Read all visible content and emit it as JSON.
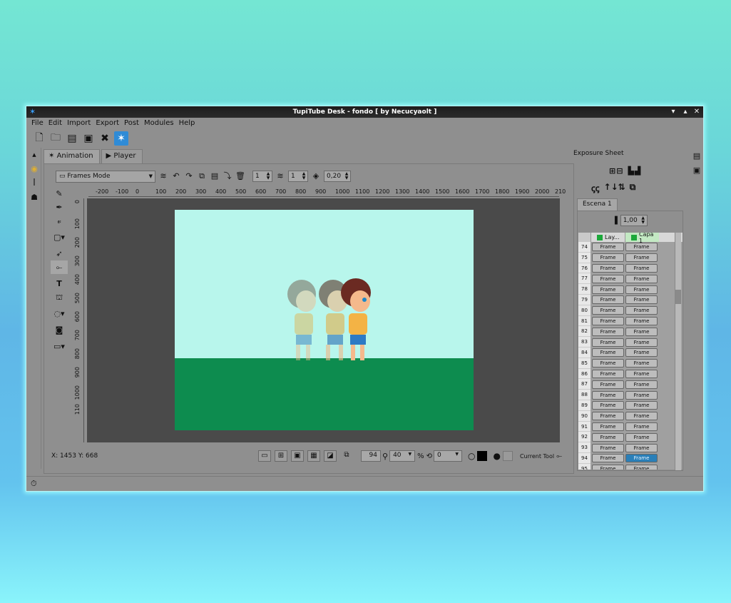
{
  "window": {
    "title": "TupiTube Desk - fondo [ by Necucyaolt ]",
    "app_icon": "tupitube-icon",
    "controls": [
      "▾",
      "▴",
      "✕"
    ]
  },
  "menu": [
    "File",
    "Edit",
    "Import",
    "Export",
    "Post",
    "Modules",
    "Help"
  ],
  "toolbar": [
    "new-file-icon",
    "open-folder-icon",
    "save-icon",
    "save-as-icon",
    "close-icon",
    "tupitube-icon"
  ],
  "tabs": {
    "animation": "Animation",
    "player": "Player"
  },
  "frames_bar": {
    "mode": "Frames Mode",
    "spin1": "1",
    "spin2": "1",
    "opacity": "0,20"
  },
  "ruler_h": [
    "-200",
    "-100",
    "0",
    "100",
    "200",
    "300",
    "400",
    "500",
    "600",
    "700",
    "800",
    "900",
    "1000",
    "1100",
    "1200",
    "1300",
    "1400",
    "1500",
    "1600",
    "1700",
    "1800",
    "1900",
    "2000",
    "210"
  ],
  "ruler_v": [
    "0",
    "100",
    "200",
    "300",
    "400",
    "500",
    "600",
    "700",
    "800",
    "900",
    "1000",
    "110"
  ],
  "status": {
    "coords": "X: 1453 Y: 668",
    "frame": "94",
    "zoom": "40",
    "percent": "%",
    "rotation": "0",
    "current_tool": "Current Tool"
  },
  "canvas": {
    "sky_color": "#b8f6ec",
    "ground_color": "#0d8c4f"
  },
  "exposure": {
    "title": "Exposure Sheet",
    "scene_tab": "Escena 1",
    "fps": "1,00",
    "layers": [
      "Lay...",
      "Capa 1"
    ],
    "rows": [
      {
        "n": "74",
        "a": "Frame",
        "b": "Frame"
      },
      {
        "n": "75",
        "a": "Frame",
        "b": "Frame"
      },
      {
        "n": "76",
        "a": "Frame",
        "b": "Frame"
      },
      {
        "n": "77",
        "a": "Frame",
        "b": "Frame"
      },
      {
        "n": "78",
        "a": "Frame",
        "b": "Frame"
      },
      {
        "n": "79",
        "a": "Frame",
        "b": "Frame"
      },
      {
        "n": "80",
        "a": "Frame",
        "b": "Frame"
      },
      {
        "n": "81",
        "a": "Frame",
        "b": "Frame"
      },
      {
        "n": "82",
        "a": "Frame",
        "b": "Frame"
      },
      {
        "n": "83",
        "a": "Frame",
        "b": "Frame"
      },
      {
        "n": "84",
        "a": "Frame",
        "b": "Frame"
      },
      {
        "n": "85",
        "a": "Frame",
        "b": "Frame"
      },
      {
        "n": "86",
        "a": "Frame",
        "b": "Frame"
      },
      {
        "n": "87",
        "a": "Frame",
        "b": "Frame"
      },
      {
        "n": "88",
        "a": "Frame",
        "b": "Frame"
      },
      {
        "n": "89",
        "a": "Frame",
        "b": "Frame"
      },
      {
        "n": "90",
        "a": "Frame",
        "b": "Frame"
      },
      {
        "n": "91",
        "a": "Frame",
        "b": "Frame"
      },
      {
        "n": "92",
        "a": "Frame",
        "b": "Frame"
      },
      {
        "n": "93",
        "a": "Frame",
        "b": "Frame"
      },
      {
        "n": "94",
        "a": "Frame",
        "b": "Frame"
      },
      {
        "n": "95",
        "a": "Frame",
        "b": "Frame"
      }
    ],
    "selected_row": "94"
  }
}
